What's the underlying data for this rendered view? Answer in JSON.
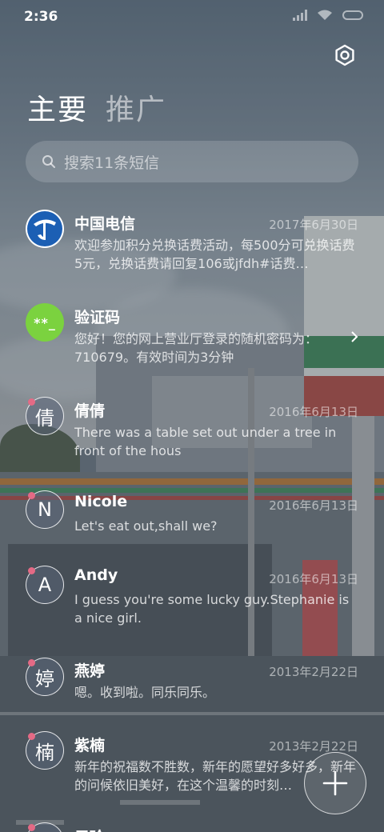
{
  "status_bar": {
    "time": "2:36"
  },
  "header": {
    "tabs": [
      {
        "label": "主要",
        "active": true
      },
      {
        "label": "推广",
        "active": false
      }
    ]
  },
  "search": {
    "placeholder": "搜索11条短信"
  },
  "messages": [
    {
      "sender": "中国电信",
      "date": "2017年6月30日",
      "preview": "欢迎参加积分兑换话费活动，每500分可兑换话费5元，兑换话费请回复106或jfdh#话费…",
      "avatar_type": "telecom-logo"
    },
    {
      "sender": "验证码",
      "date": "",
      "preview": "您好！您的网上营业厅登录的随机密码为：710679。有效时间为3分钟",
      "avatar_text": "**_",
      "avatar_type": "verification-code"
    },
    {
      "sender": "倩倩",
      "date": "2016年6月13日",
      "preview": "There was a table set out under a tree in front of the hous",
      "avatar_text": "倩"
    },
    {
      "sender": "Nicole",
      "date": "2016年6月13日",
      "preview": "Let's eat out,shall we?",
      "avatar_text": "N"
    },
    {
      "sender": "Andy",
      "date": "2016年6月13日",
      "preview": "I guess you're some lucky guy.Stephanie is a nice girl.",
      "avatar_text": "A"
    },
    {
      "sender": "燕婷",
      "date": "2013年2月22日",
      "preview": "嗯。收到啦。同乐同乐。",
      "avatar_text": "婷"
    },
    {
      "sender": "紫楠",
      "date": "2013年2月22日",
      "preview": "新年的祝福数不胜数，新年的愿望好多好多，新年的问候依旧美好，在这个温馨的时刻…",
      "avatar_text": "楠"
    },
    {
      "sender": "子玲",
      "date": "",
      "preview": "",
      "avatar_text": ""
    }
  ],
  "colors": {
    "verification_avatar": "#7bd23f",
    "telecom_blue": "#1c5fb4",
    "unread_dot": "#e46a85"
  },
  "icons": {
    "settings": "gear-icon",
    "search": "search-icon",
    "compose": "plus-icon",
    "chevron": "chevron-right-icon"
  }
}
